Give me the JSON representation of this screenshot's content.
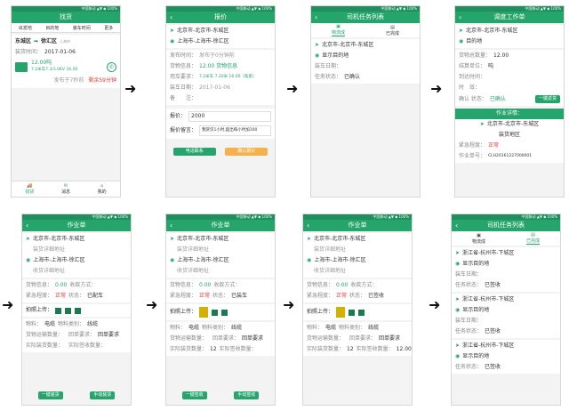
{
  "common": {
    "status_text": "中国移动 ▲▼ ◆ 100%"
  },
  "s1": {
    "title": "找货",
    "filters": [
      "出发地",
      "目的地",
      "装车时间",
      "更多"
    ],
    "route_from": "东城区",
    "route_to": "徐汇区",
    "route_note": "上海市",
    "time_label": "装货时间：",
    "time_value": "2017-01-06",
    "weight": "12.00吨",
    "vehicle": "7.2米车7.3/3.0KV 16.00",
    "posted": "发布于7秒前",
    "remain": "剩余59分钟",
    "tabs": [
      "找货",
      "消息",
      "我的"
    ]
  },
  "s2": {
    "title": "报价",
    "from": "北京市-北京市-东城区",
    "to": "上海市-上海市-徐汇区",
    "rows": [
      {
        "k": "发布时间：",
        "v": "发布于0分钟前"
      },
      {
        "k": "货物信息：",
        "v": "12.00  货物信息"
      },
      {
        "k": "用车要求：",
        "v": "7.2米车 7.20米 16.00（吨第）"
      },
      {
        "k": "装车日期：",
        "v": "2017-01-06"
      },
      {
        "k": "备　　注：",
        "v": ""
      }
    ],
    "price_label": "报价：",
    "price_value": "2000",
    "msg_label": "报价留言：",
    "msg_value": "我赏仅1小时,超出每小时加100",
    "btn_cancel": "电话联系",
    "btn_submit": "确认报价"
  },
  "s3": {
    "title": "司机任务列表",
    "tabs": [
      "物流成",
      "已完成"
    ],
    "from": "北京市-北京市-东城区",
    "to": "显示目的地",
    "date_label": "装车日期：",
    "status_label": "任务状态：",
    "status_value": "已确认"
  },
  "s4": {
    "title": "调度工作单",
    "from": "北京市-北京市-东城区",
    "to": "目的地",
    "rows": [
      {
        "k": "货物总数量：",
        "v": "12.00"
      },
      {
        "k": "结算单位：",
        "v": "吨"
      },
      {
        "k": "到达时间：",
        "v": ""
      },
      {
        "k": "时　效：",
        "v": ""
      }
    ],
    "confirm_label": "确认 状态：",
    "confirm_value": "已确认",
    "confirm_btn": "一键返货",
    "work_details": "作业详情：",
    "addr": "北京市-北京市-东城区",
    "addr2": "装货地区",
    "urgency_label": "紧急程度：",
    "urgency_value": "正常",
    "order_label": "作业单号：",
    "order_value": "CLH20161227000001"
  },
  "s5": {
    "title": "作业单",
    "from": "北京市-北京市-东城区",
    "from2": "装货详细地址",
    "to": "上海市-上海市-徐汇区",
    "to2": "收货详细地址",
    "goods_label": "货物信息：",
    "goods_value": "0.00",
    "recv_label": "收款方式：",
    "urgency_label": "紧急程度：",
    "urgency_value": "正常",
    "status_label": "状态：",
    "status_value": "已配车",
    "upload": "拍照上传：",
    "mat_label": "物料：",
    "mat_value": "电缆",
    "matcat_label": "物料类别：",
    "matcat_value": "线缆",
    "trans_label": "货物运输数量：",
    "trans_value": "",
    "sign_label": "回单要求：",
    "sign_value": "回单要求",
    "act_label": "实际装货数量：",
    "act_value": "",
    "recvq_label": "实际签收数量：",
    "recvq_value": "",
    "btn1": "一键装货",
    "btn2": "手动装货"
  },
  "s6": {
    "title": "作业单",
    "from": "北京市-北京市-东城区",
    "from2": "装货详细地址",
    "to": "上海市-上海市-徐汇区",
    "to2": "收货详细地址",
    "goods_label": "货物信息：",
    "goods_value": "0.00",
    "recv_label": "收款方式：",
    "urgency_label": "紧急程度：",
    "urgency_value": "正常",
    "status_label": "状态：",
    "status_value": "已装车",
    "upload": "拍照上传：",
    "mat_label": "物料：",
    "mat_value": "电缆",
    "matcat_label": "物料类别：",
    "matcat_value": "线缆",
    "trans_label": "货物运输数量：",
    "trans_value": "",
    "sign_label": "回单要求：",
    "sign_value": "回单要求",
    "act_label": "实际装货数量：",
    "act_value": "12",
    "recvq_label": "实际签收数量：",
    "recvq_value": "",
    "btn1": "一键签收",
    "btn2": "手动签收"
  },
  "s7": {
    "title": "作业单",
    "from": "北京市-北京市-东城区",
    "from2": "装货详细地址",
    "to": "上海市-上海市-徐汇区",
    "to2": "收货详细地址",
    "goods_label": "货物信息：",
    "goods_value": "0.00",
    "recv_label": "收款方式：",
    "urgency_label": "紧急程度：",
    "urgency_value": "正常",
    "status_label": "状态：",
    "status_value": "已签收",
    "upload": "拍照上传：",
    "mat_label": "物料：",
    "mat_value": "电缆",
    "matcat_label": "物料类别：",
    "matcat_value": "线缆",
    "trans_label": "货物运输数量：",
    "trans_value": "",
    "sign_label": "回单要求：",
    "sign_value": "回单要求",
    "act_label": "实际装货数量：",
    "act_value": "12",
    "recvq_label": "实际签收数量：",
    "recvq_value": "12.00"
  },
  "s8": {
    "title": "司机任务列表",
    "tabs": [
      "物流成",
      "已完成"
    ],
    "items": [
      {
        "from": "浙江省-杭州市-下城区",
        "to": "显示目的地",
        "date": "装车日期：",
        "status": "已签收"
      },
      {
        "from": "浙江省-杭州市-下城区",
        "to": "显示目的地",
        "date": "装车日期：",
        "status": "已签收"
      },
      {
        "from": "浙江省-杭州市-下城区",
        "to": "显示目的地",
        "date": "",
        "status": "已签收"
      }
    ],
    "status_label": "任务状态："
  }
}
